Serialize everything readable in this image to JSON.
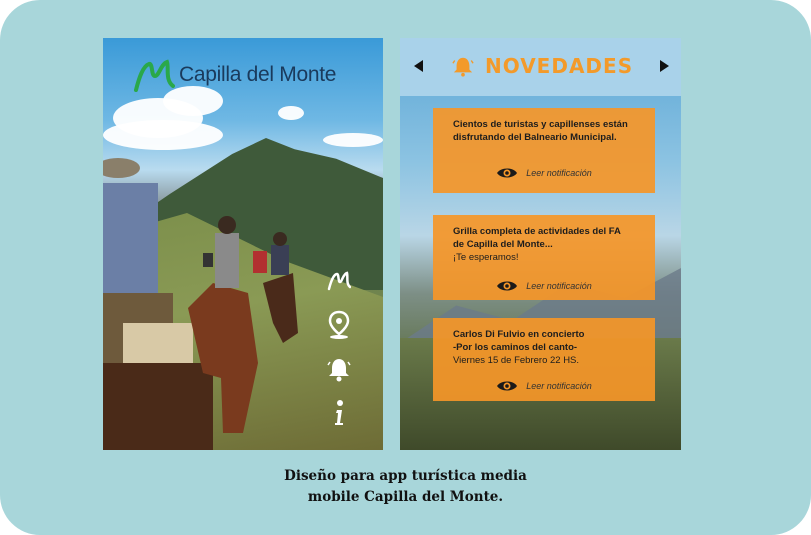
{
  "left_screen": {
    "logo_text": "Capilla del Monte",
    "side_icons": [
      "mountain-icon",
      "location-pin-icon",
      "bell-icon",
      "info-icon"
    ]
  },
  "right_screen": {
    "header_title": "NOVEDADES",
    "notifications": [
      {
        "line1": "Cientos de turistas y capillenses están",
        "line2": "disfrutando del Balneario Municipal.",
        "line3": "",
        "action": "Leer notificación"
      },
      {
        "line1": "Grilla completa de actividades del FA",
        "line2": "de Capilla del Monte...",
        "line3": "¡Te esperamos!",
        "action": "Leer notificación"
      },
      {
        "line1": "Carlos Di Fulvio en concierto",
        "line2": "-Por los caminos del canto-",
        "line3": "Viernes 15 de Febrero 22 HS.",
        "action": "Leer notificación"
      }
    ]
  },
  "caption": {
    "line1": "Diseño para app turística media",
    "line2": "mobile Capilla del Monte."
  },
  "colors": {
    "background": "#a8d6da",
    "accent_orange": "#f39a2a",
    "logo_green": "#2aa84a",
    "logo_navy": "#1a3a5c"
  }
}
